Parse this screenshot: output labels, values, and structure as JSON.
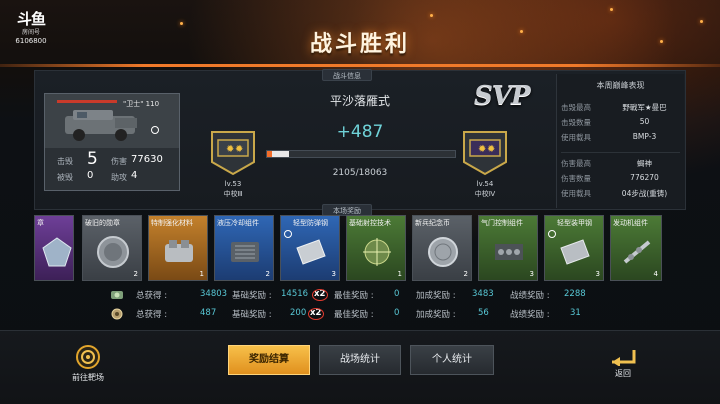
{
  "logo": {
    "mark": "斗鱼",
    "sub": "房间号",
    "room_id": "6106800"
  },
  "title": "战斗胜利",
  "battle_info_tag": "战斗信息",
  "player": {
    "tank_name": "\"卫士\" 110",
    "kills_label": "击毁",
    "kills": "5",
    "damage_label": "伤害",
    "damage": "77630",
    "killed_label": "被毁",
    "killed": "0",
    "assist_label": "助攻",
    "assist": "4"
  },
  "map_name": "平沙落雁式",
  "xp_gain": "+487",
  "xp_progress": "2105/18063",
  "xp_fraction": 0.1165,
  "rank_left": {
    "level": "lv.53",
    "rank": "中校Ⅲ"
  },
  "rank_right": {
    "level": "lv.54",
    "rank": "中校Ⅳ"
  },
  "svp": "SVP",
  "weekly": {
    "title": "本周巅峰表现",
    "rows": [
      {
        "k": "击毁最高",
        "v": "野戰军★曼巴"
      },
      {
        "k": "击毁数量",
        "v": "50"
      },
      {
        "k": "使用载具",
        "v": "BMP-3"
      },
      {
        "k": "伤害最高",
        "v": "蝎神"
      },
      {
        "k": "伤害数量",
        "v": "776270"
      },
      {
        "k": "使用载具",
        "v": "04步战(重铸)"
      }
    ]
  },
  "rewards_tag": "本场奖励",
  "rewards": [
    {
      "name": "章",
      "quality": "purple",
      "count": ""
    },
    {
      "name": "破旧的勋章",
      "quality": "gray",
      "count": "2"
    },
    {
      "name": "特制强化材料",
      "quality": "orange",
      "count": "1"
    },
    {
      "name": "液压冷却组件",
      "quality": "blue",
      "count": "2"
    },
    {
      "name": "轻型防弹钢",
      "quality": "blue",
      "count": "3"
    },
    {
      "name": "基础射控技术",
      "quality": "green",
      "count": "1"
    },
    {
      "name": "新兵纪念币",
      "quality": "gray",
      "count": "2"
    },
    {
      "name": "气门控制组件",
      "quality": "green",
      "count": "3"
    },
    {
      "name": "轻型装甲钢",
      "quality": "green",
      "count": "3"
    },
    {
      "name": "发动机组件",
      "quality": "green",
      "count": "4"
    }
  ],
  "summary": {
    "labels": {
      "total": "总获得 :",
      "base": "基础奖励 :",
      "best": "最佳奖励 :",
      "bonus": "加成奖励 :",
      "perf": "战绩奖励 :"
    },
    "multiplier": "x2",
    "silver": {
      "total": "34803",
      "base": "14516",
      "best": "0",
      "bonus": "3483",
      "perf": "2288"
    },
    "exp": {
      "total": "487",
      "base": "200",
      "best": "0",
      "bonus": "56",
      "perf": "31"
    }
  },
  "bottom": {
    "goto_range": "前往靶场",
    "btn_settle": "奖励结算",
    "btn_battle": "战场统计",
    "btn_personal": "个人统计",
    "back": "返回"
  },
  "colors": {
    "accent": "#f07a2a",
    "cyan": "#58c8d6",
    "gold": "#f7c04a"
  }
}
